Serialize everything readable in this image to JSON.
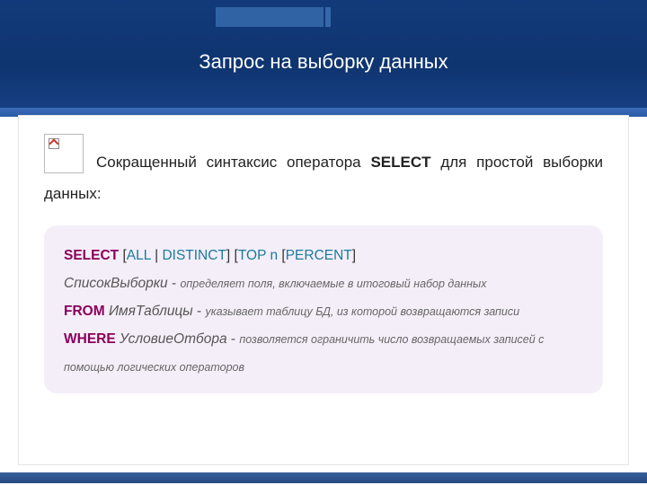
{
  "title": "Запрос на выборку данных",
  "lead": {
    "part1": "Сокращенный синтаксис оператора ",
    "strong": "SELECT",
    "part2": " для простой выборки данных:"
  },
  "syntax": {
    "select": "SELECT",
    "lbr1": " [",
    "all": "ALL",
    "pipe": " | ",
    "distinct": "DISTINCT",
    "rbr1": "] [",
    "top": "TOP",
    "space1": " ",
    "n": "n",
    "space2": " [",
    "percent": "PERCENT",
    "rbr2": "]",
    "spisok": "СписокВыборки",
    "dash1": " - ",
    "desc1": "определяет поля, включаемые в итоговый набор данных",
    "from": "FROM",
    "space3": " ",
    "table": "ИмяТаблицы",
    "dash2": " - ",
    "desc2": "указывает таблицу БД, из которой возвращаются записи",
    "where": "WHERE",
    "space4": " ",
    "cond": "УсловиеОтбора",
    "dash3": " - ",
    "desc3": "позволяется ограничить число возвращаемых записей с помощью логических операторов"
  }
}
